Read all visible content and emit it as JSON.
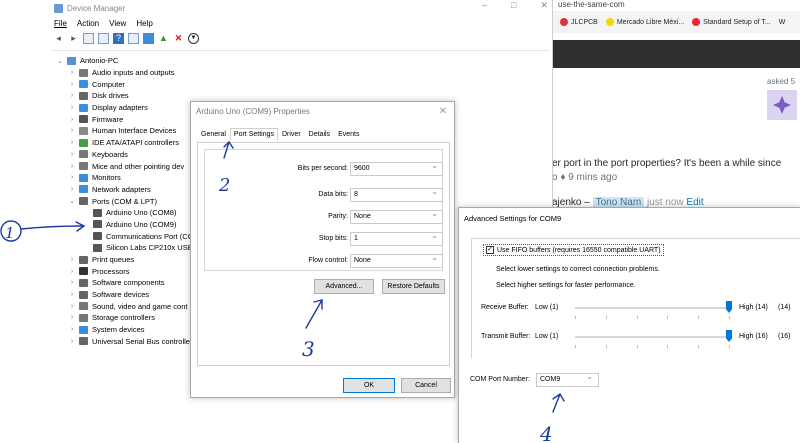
{
  "browser": {
    "url_fragment": "use-the-same-com",
    "bookmarks": [
      {
        "label": "JLCPCB",
        "color": "#d33"
      },
      {
        "label": "Mercado Libre Méxi...",
        "color": "#f5d800"
      },
      {
        "label": "Standard Setup of T...",
        "color": "#e23"
      },
      {
        "label": "W",
        "color": "#555"
      }
    ],
    "asked": "asked 5",
    "comment_line1": "er port in the port properties? It's been a while since",
    "comment_line2": "o ♦ 9 mins ago",
    "reply_prefix": "ajenko –",
    "reply_user": "Tono Nam",
    "reply_time": "just now",
    "reply_edit": "Edit"
  },
  "device_manager": {
    "title": "Device Manager",
    "window_buttons": [
      "–",
      "□",
      "✕"
    ],
    "menu": [
      "File",
      "Action",
      "View",
      "Help"
    ],
    "tree": [
      {
        "label": "Antonio-PC",
        "level": 0,
        "chev": "⌄",
        "color": "#5a8fd6"
      },
      {
        "label": "Audio inputs and outputs",
        "level": 1,
        "chev": "›",
        "color": "#777"
      },
      {
        "label": "Computer",
        "level": 1,
        "chev": "›",
        "color": "#3a8fd8"
      },
      {
        "label": "Disk drives",
        "level": 1,
        "chev": "›",
        "color": "#666"
      },
      {
        "label": "Display adapters",
        "level": 1,
        "chev": "›",
        "color": "#3a8fd8"
      },
      {
        "label": "Firmware",
        "level": 1,
        "chev": "›",
        "color": "#555"
      },
      {
        "label": "Human Interface Devices",
        "level": 1,
        "chev": "›",
        "color": "#888"
      },
      {
        "label": "IDE ATA/ATAPI controllers",
        "level": 1,
        "chev": "›",
        "color": "#4a9a4a"
      },
      {
        "label": "Keyboards",
        "level": 1,
        "chev": "›",
        "color": "#777"
      },
      {
        "label": "Mice and other pointing dev",
        "level": 1,
        "chev": "›",
        "color": "#777"
      },
      {
        "label": "Monitors",
        "level": 1,
        "chev": "›",
        "color": "#3a8fd8"
      },
      {
        "label": "Network adapters",
        "level": 1,
        "chev": "›",
        "color": "#3a8fd8"
      },
      {
        "label": "Ports (COM & LPT)",
        "level": 1,
        "chev": "⌄",
        "color": "#666"
      },
      {
        "label": "Arduino Uno (COM8)",
        "level": 2,
        "chev": "",
        "color": "#555"
      },
      {
        "label": "Arduino Uno (COM9)",
        "level": 2,
        "chev": "",
        "color": "#555"
      },
      {
        "label": "Communications Port (CC",
        "level": 2,
        "chev": "",
        "color": "#555"
      },
      {
        "label": "Silicon Labs CP210x USB t",
        "level": 2,
        "chev": "",
        "color": "#555"
      },
      {
        "label": "Print queues",
        "level": 1,
        "chev": "›",
        "color": "#666"
      },
      {
        "label": "Processors",
        "level": 1,
        "chev": "›",
        "color": "#333"
      },
      {
        "label": "Software components",
        "level": 1,
        "chev": "›",
        "color": "#666"
      },
      {
        "label": "Software devices",
        "level": 1,
        "chev": "›",
        "color": "#666"
      },
      {
        "label": "Sound, video and game cont",
        "level": 1,
        "chev": "›",
        "color": "#777"
      },
      {
        "label": "Storage controllers",
        "level": 1,
        "chev": "›",
        "color": "#777"
      },
      {
        "label": "System devices",
        "level": 1,
        "chev": "›",
        "color": "#3a8fd8"
      },
      {
        "label": "Universal Serial Bus controlle",
        "level": 1,
        "chev": "›",
        "color": "#666"
      }
    ]
  },
  "properties": {
    "title": "Arduino Uno (COM9) Properties",
    "close": "✕",
    "tabs": [
      "General",
      "Port Settings",
      "Driver",
      "Details",
      "Events"
    ],
    "active_tab": "Port Settings",
    "fields": [
      {
        "label": "Bits per second:",
        "value": "9600"
      },
      {
        "label": "Data bits:",
        "value": "8"
      },
      {
        "label": "Parity:",
        "value": "None"
      },
      {
        "label": "Stop bits:",
        "value": "1"
      },
      {
        "label": "Flow control:",
        "value": "None"
      }
    ],
    "advanced_button": "Advanced...",
    "restore_button": "Restore Defaults",
    "ok_button": "OK",
    "cancel_button": "Cancel"
  },
  "advanced": {
    "title": "Advanced Settings for COM9",
    "fifo_label": "Use FIFO buffers (requires 16550 compatible UART)",
    "fifo_checked": "✓",
    "hint1": "Select lower settings to correct connection problems.",
    "hint2": "Select higher settings for faster performance.",
    "receive_label": "Receive Buffer:",
    "receive_low": "Low (1)",
    "receive_high": "High (14)",
    "receive_value": "(14)",
    "transmit_label": "Transmit Buffer:",
    "transmit_low": "Low (1)",
    "transmit_high": "High (16)",
    "transmit_value": "(16)",
    "com_label": "COM Port Number:",
    "com_value": "COM9"
  },
  "annotations": [
    "1",
    "2",
    "3",
    "4"
  ]
}
